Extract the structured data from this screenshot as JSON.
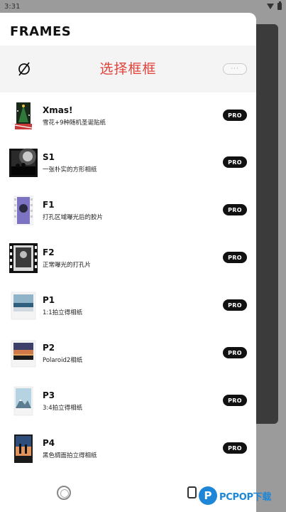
{
  "status_bar": {
    "time": "3:31"
  },
  "drawer": {
    "title": "FRAMES",
    "selector": {
      "title": "选择框框",
      "more_label": "···"
    }
  },
  "frames": [
    {
      "name": "Xmas!",
      "desc": "雪花+9种随机圣诞贴纸",
      "badge": "PRO",
      "thumb": "xmas"
    },
    {
      "name": "S1",
      "desc": "一张朴实的方形相纸",
      "badge": "PRO",
      "thumb": "s1"
    },
    {
      "name": "F1",
      "desc": "打孔区域曝光后的胶片",
      "badge": "PRO",
      "thumb": "f1"
    },
    {
      "name": "F2",
      "desc": "正常曝光的打孔片",
      "badge": "PRO",
      "thumb": "f2"
    },
    {
      "name": "P1",
      "desc": "1:1拍立得相纸",
      "badge": "PRO",
      "thumb": "p1"
    },
    {
      "name": "P2",
      "desc": "Polaroid2相纸",
      "badge": "PRO",
      "thumb": "p2"
    },
    {
      "name": "P3",
      "desc": "3:4拍立得相纸",
      "badge": "PRO",
      "thumb": "p3"
    },
    {
      "name": "P4",
      "desc": "黑色绸面拍立得相纸",
      "badge": "PRO",
      "thumb": "p4"
    }
  ],
  "watermark": {
    "logo_letter": "P",
    "text": "PCPOP下载"
  },
  "colors": {
    "accent": "#e0413b",
    "badge": "#111111",
    "watermark": "#1e86d6"
  }
}
